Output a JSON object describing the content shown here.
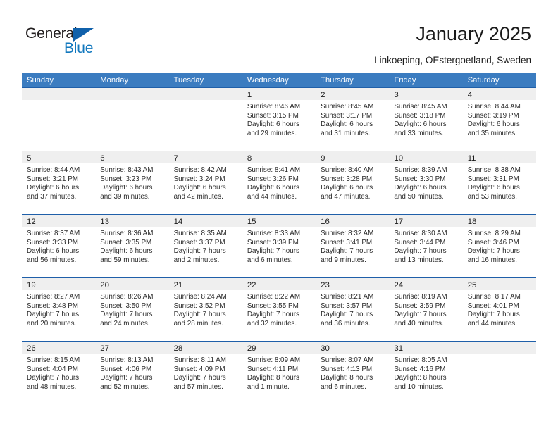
{
  "brand": {
    "name_part1": "General",
    "name_part2": "Blue",
    "triangle_color": "#1061ab",
    "blue_color": "#1278be"
  },
  "header": {
    "title": "January 2025",
    "subtitle": "Linkoeping, OEstergoetland, Sweden"
  },
  "theme": {
    "header_bg": "#3b7cc0",
    "cell_divider": "#1f5fa9",
    "datebar_bg": "#efefef"
  },
  "weekdays": [
    "Sunday",
    "Monday",
    "Tuesday",
    "Wednesday",
    "Thursday",
    "Friday",
    "Saturday"
  ],
  "weeks": [
    [
      {
        "day": "",
        "lines": []
      },
      {
        "day": "",
        "lines": []
      },
      {
        "day": "",
        "lines": []
      },
      {
        "day": "1",
        "lines": [
          "Sunrise: 8:46 AM",
          "Sunset: 3:15 PM",
          "Daylight: 6 hours",
          "and 29 minutes."
        ]
      },
      {
        "day": "2",
        "lines": [
          "Sunrise: 8:45 AM",
          "Sunset: 3:17 PM",
          "Daylight: 6 hours",
          "and 31 minutes."
        ]
      },
      {
        "day": "3",
        "lines": [
          "Sunrise: 8:45 AM",
          "Sunset: 3:18 PM",
          "Daylight: 6 hours",
          "and 33 minutes."
        ]
      },
      {
        "day": "4",
        "lines": [
          "Sunrise: 8:44 AM",
          "Sunset: 3:19 PM",
          "Daylight: 6 hours",
          "and 35 minutes."
        ]
      }
    ],
    [
      {
        "day": "5",
        "lines": [
          "Sunrise: 8:44 AM",
          "Sunset: 3:21 PM",
          "Daylight: 6 hours",
          "and 37 minutes."
        ]
      },
      {
        "day": "6",
        "lines": [
          "Sunrise: 8:43 AM",
          "Sunset: 3:23 PM",
          "Daylight: 6 hours",
          "and 39 minutes."
        ]
      },
      {
        "day": "7",
        "lines": [
          "Sunrise: 8:42 AM",
          "Sunset: 3:24 PM",
          "Daylight: 6 hours",
          "and 42 minutes."
        ]
      },
      {
        "day": "8",
        "lines": [
          "Sunrise: 8:41 AM",
          "Sunset: 3:26 PM",
          "Daylight: 6 hours",
          "and 44 minutes."
        ]
      },
      {
        "day": "9",
        "lines": [
          "Sunrise: 8:40 AM",
          "Sunset: 3:28 PM",
          "Daylight: 6 hours",
          "and 47 minutes."
        ]
      },
      {
        "day": "10",
        "lines": [
          "Sunrise: 8:39 AM",
          "Sunset: 3:30 PM",
          "Daylight: 6 hours",
          "and 50 minutes."
        ]
      },
      {
        "day": "11",
        "lines": [
          "Sunrise: 8:38 AM",
          "Sunset: 3:31 PM",
          "Daylight: 6 hours",
          "and 53 minutes."
        ]
      }
    ],
    [
      {
        "day": "12",
        "lines": [
          "Sunrise: 8:37 AM",
          "Sunset: 3:33 PM",
          "Daylight: 6 hours",
          "and 56 minutes."
        ]
      },
      {
        "day": "13",
        "lines": [
          "Sunrise: 8:36 AM",
          "Sunset: 3:35 PM",
          "Daylight: 6 hours",
          "and 59 minutes."
        ]
      },
      {
        "day": "14",
        "lines": [
          "Sunrise: 8:35 AM",
          "Sunset: 3:37 PM",
          "Daylight: 7 hours",
          "and 2 minutes."
        ]
      },
      {
        "day": "15",
        "lines": [
          "Sunrise: 8:33 AM",
          "Sunset: 3:39 PM",
          "Daylight: 7 hours",
          "and 6 minutes."
        ]
      },
      {
        "day": "16",
        "lines": [
          "Sunrise: 8:32 AM",
          "Sunset: 3:41 PM",
          "Daylight: 7 hours",
          "and 9 minutes."
        ]
      },
      {
        "day": "17",
        "lines": [
          "Sunrise: 8:30 AM",
          "Sunset: 3:44 PM",
          "Daylight: 7 hours",
          "and 13 minutes."
        ]
      },
      {
        "day": "18",
        "lines": [
          "Sunrise: 8:29 AM",
          "Sunset: 3:46 PM",
          "Daylight: 7 hours",
          "and 16 minutes."
        ]
      }
    ],
    [
      {
        "day": "19",
        "lines": [
          "Sunrise: 8:27 AM",
          "Sunset: 3:48 PM",
          "Daylight: 7 hours",
          "and 20 minutes."
        ]
      },
      {
        "day": "20",
        "lines": [
          "Sunrise: 8:26 AM",
          "Sunset: 3:50 PM",
          "Daylight: 7 hours",
          "and 24 minutes."
        ]
      },
      {
        "day": "21",
        "lines": [
          "Sunrise: 8:24 AM",
          "Sunset: 3:52 PM",
          "Daylight: 7 hours",
          "and 28 minutes."
        ]
      },
      {
        "day": "22",
        "lines": [
          "Sunrise: 8:22 AM",
          "Sunset: 3:55 PM",
          "Daylight: 7 hours",
          "and 32 minutes."
        ]
      },
      {
        "day": "23",
        "lines": [
          "Sunrise: 8:21 AM",
          "Sunset: 3:57 PM",
          "Daylight: 7 hours",
          "and 36 minutes."
        ]
      },
      {
        "day": "24",
        "lines": [
          "Sunrise: 8:19 AM",
          "Sunset: 3:59 PM",
          "Daylight: 7 hours",
          "and 40 minutes."
        ]
      },
      {
        "day": "25",
        "lines": [
          "Sunrise: 8:17 AM",
          "Sunset: 4:01 PM",
          "Daylight: 7 hours",
          "and 44 minutes."
        ]
      }
    ],
    [
      {
        "day": "26",
        "lines": [
          "Sunrise: 8:15 AM",
          "Sunset: 4:04 PM",
          "Daylight: 7 hours",
          "and 48 minutes."
        ]
      },
      {
        "day": "27",
        "lines": [
          "Sunrise: 8:13 AM",
          "Sunset: 4:06 PM",
          "Daylight: 7 hours",
          "and 52 minutes."
        ]
      },
      {
        "day": "28",
        "lines": [
          "Sunrise: 8:11 AM",
          "Sunset: 4:09 PM",
          "Daylight: 7 hours",
          "and 57 minutes."
        ]
      },
      {
        "day": "29",
        "lines": [
          "Sunrise: 8:09 AM",
          "Sunset: 4:11 PM",
          "Daylight: 8 hours",
          "and 1 minute."
        ]
      },
      {
        "day": "30",
        "lines": [
          "Sunrise: 8:07 AM",
          "Sunset: 4:13 PM",
          "Daylight: 8 hours",
          "and 6 minutes."
        ]
      },
      {
        "day": "31",
        "lines": [
          "Sunrise: 8:05 AM",
          "Sunset: 4:16 PM",
          "Daylight: 8 hours",
          "and 10 minutes."
        ]
      },
      {
        "day": "",
        "lines": []
      }
    ]
  ]
}
